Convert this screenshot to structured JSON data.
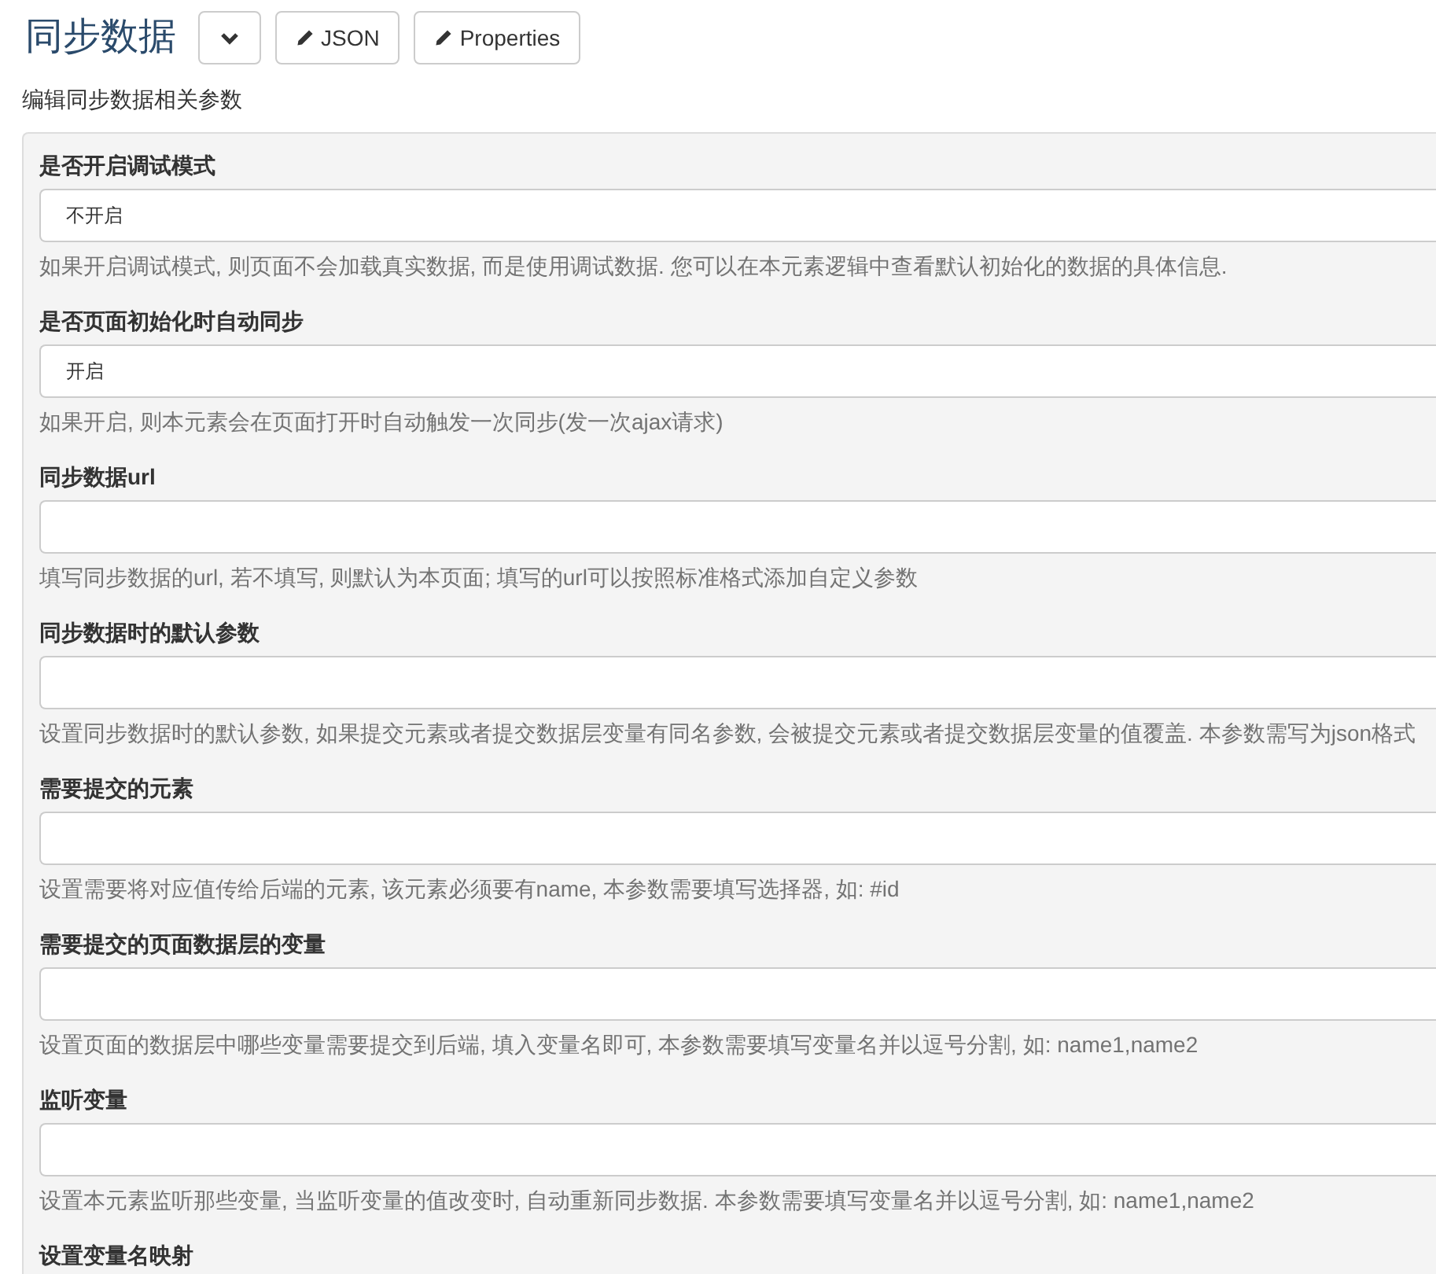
{
  "header": {
    "title": "同步数据",
    "buttons": [
      {
        "kind": "caret"
      },
      {
        "kind": "pencil",
        "label": "JSON"
      },
      {
        "kind": "pencil",
        "label": "Properties"
      }
    ]
  },
  "description": "编辑同步数据相关参数",
  "fields": [
    {
      "label": "是否开启调试模式",
      "kind": "select",
      "value": "不开启",
      "help": "如果开启调试模式, 则页面不会加载真实数据, 而是使用调试数据. 您可以在本元素逻辑中查看默认初始化的数据的具体信息."
    },
    {
      "label": "是否页面初始化时自动同步",
      "kind": "select",
      "value": "开启",
      "help": "如果开启, 则本元素会在页面打开时自动触发一次同步(发一次ajax请求)"
    },
    {
      "label": "同步数据url",
      "kind": "text",
      "help": "填写同步数据的url, 若不填写, 则默认为本页面; 填写的url可以按照标准格式添加自定义参数"
    },
    {
      "label": "同步数据时的默认参数",
      "kind": "text",
      "help": "设置同步数据时的默认参数, 如果提交元素或者提交数据层变量有同名参数, 会被提交元素或者提交数据层变量的值覆盖. 本参数需写为json格式"
    },
    {
      "label": "需要提交的元素",
      "kind": "text",
      "help": "设置需要将对应值传给后端的元素, 该元素必须要有name, 本参数需要填写选择器, 如: #id"
    },
    {
      "label": "需要提交的页面数据层的变量",
      "kind": "text",
      "help": "设置页面的数据层中哪些变量需要提交到后端, 填入变量名即可, 本参数需要填写变量名并以逗号分割, 如: name1,name2"
    },
    {
      "label": "监听变量",
      "kind": "text",
      "help": "设置本元素监听那些变量, 当监听变量的值改变时, 自动重新同步数据. 本参数需要填写变量名并以逗号分割, 如: name1,name2"
    },
    {
      "label": "设置变量名映射",
      "kind": "label"
    }
  ]
}
